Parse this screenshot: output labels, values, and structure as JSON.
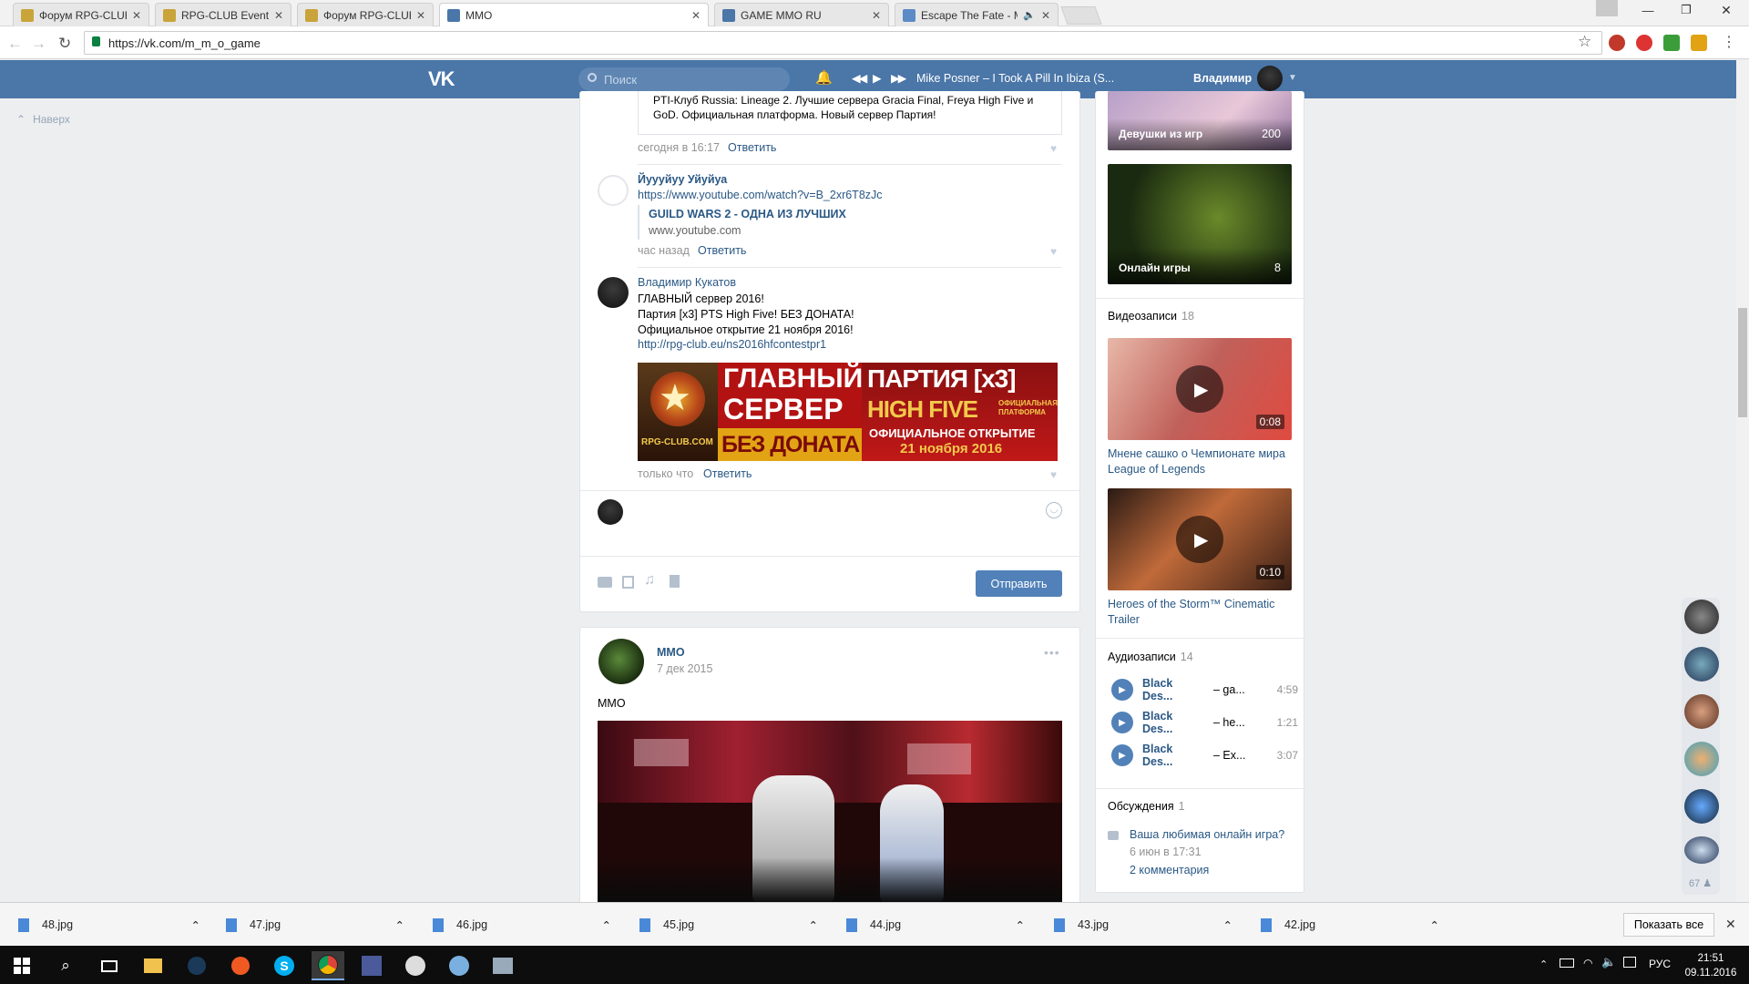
{
  "tabs": [
    {
      "label": "Форум RPG-CLUB. Тема:",
      "icon": "rpg-club-favicon"
    },
    {
      "label": "RPG-CLUB Events Screen",
      "icon": "rpg-club-favicon"
    },
    {
      "label": "Форум RPG-CLUB. Тема:",
      "icon": "rpg-club-favicon"
    },
    {
      "label": "MMO",
      "icon": "vk-favicon",
      "active": true
    },
    {
      "label": "GAME MMO RU",
      "icon": "vk-favicon"
    },
    {
      "label": "Escape The Fate - My",
      "icon": "youtube-favicon"
    }
  ],
  "address_url": "https://vk.com/m_m_o_game",
  "header": {
    "search_placeholder": "Поиск",
    "player_track": "Mike Posner – I Took A Pill In Ibiza (S...",
    "user_name": "Владимир"
  },
  "left": {
    "back_to_top": "Наверх"
  },
  "comments": [
    {
      "text": "PTI-Клуб Russia: Lineage 2. Лучшие сервера Gracia Final, Freya High Five и GoD. Официальная платформа. Новый сервер Партия!",
      "time": "сегодня в 16:17",
      "reply": "Ответить"
    },
    {
      "author": "Йуууйуу Уйуйуа",
      "url": "https://www.youtube.com/watch?v=B_2xr6T8zJc",
      "attach_title": "GUILD WARS 2 - ОДНА ИЗ ЛУЧШИХ",
      "attach_domain": "www.youtube.com",
      "time": "час назад",
      "reply": "Ответить"
    },
    {
      "author": "Владимир Кукатов",
      "lines": [
        "ГЛАВНЫЙ сервер 2016!",
        "Партия [x3] PTS High Five! БЕЗ ДОНАТА!",
        "Официальное открытие 21 ноября 2016!"
      ],
      "link": "http://rpg-club.eu/ns2016hfcontestpr1",
      "time": "только что",
      "reply": "Ответить",
      "banner": {
        "site": "RPG-CLUB.COM",
        "l1": "ГЛАВНЫЙ",
        "l2": "СЕРВЕР",
        "l3": "БЕЗ ДОНАТА",
        "r1": "ПАРТИЯ [x3]",
        "r2": "HIGH FIVE",
        "r2b": "ОФИЦИАЛЬНАЯ ПЛАТФОРМА",
        "r3": "ОФИЦИАЛЬНОЕ ОТКРЫТИЕ",
        "r4": "21 ноября 2016"
      }
    }
  ],
  "send_button": "Отправить",
  "post": {
    "author": "MMO",
    "date": "7 дек 2015",
    "text": "MMO"
  },
  "sidebar": {
    "albums": [
      {
        "title": "Девушки из игр",
        "count": "200"
      },
      {
        "title": "Онлайн игры",
        "count": "8"
      }
    ],
    "videos_label": "Видеозаписи",
    "videos_count": "18",
    "videos": [
      {
        "duration": "0:08",
        "title": "Мнене сашко о Чемпионате мира League of Legends"
      },
      {
        "duration": "0:10",
        "title": "Heroes of the Storm™ Cinematic Trailer"
      }
    ],
    "audio_label": "Аудиозаписи",
    "audio_count": "14",
    "audios": [
      {
        "artist": "Black Des...",
        "title": "– ga...",
        "duration": "4:59"
      },
      {
        "artist": "Black Des...",
        "title": "– he...",
        "duration": "1:21"
      },
      {
        "artist": "Black Des...",
        "title": "– Ex...",
        "duration": "3:07"
      }
    ],
    "discussions_label": "Обсуждения",
    "discussions_count": "1",
    "discussion": {
      "title": "Ваша любимая онлайн игра?",
      "date": "6 июн в 17:31",
      "comments": "2 комментария"
    }
  },
  "friends_count": "67",
  "downloads": [
    "48.jpg",
    "47.jpg",
    "46.jpg",
    "45.jpg",
    "44.jpg",
    "43.jpg",
    "42.jpg"
  ],
  "show_all": "Показать все",
  "taskbar": {
    "lang": "РУС",
    "time": "21:51",
    "date": "09.11.2016"
  },
  "colors": {
    "vk_blue": "#4a76a8",
    "link": "#2a5885",
    "send_button": "#5181b8"
  }
}
